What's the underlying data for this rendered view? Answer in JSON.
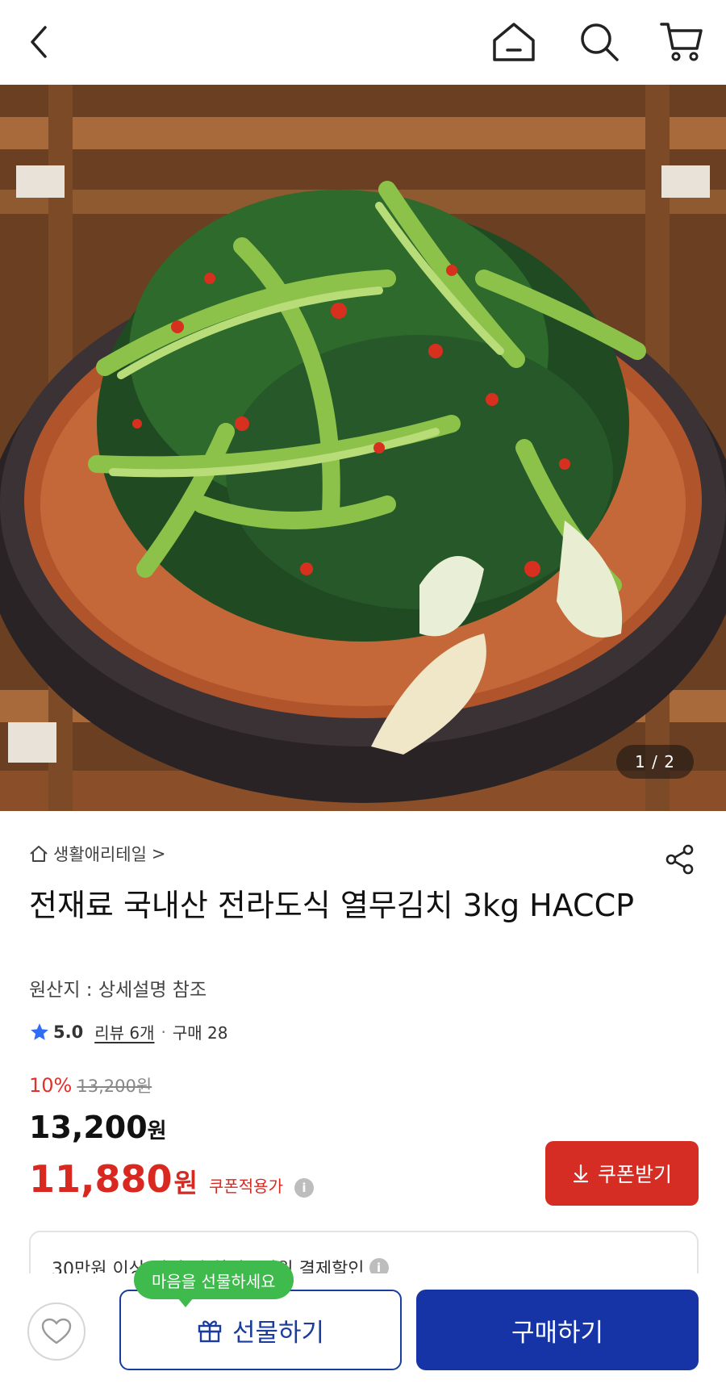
{
  "header": {
    "back_icon": "chevron-left-icon",
    "home_icon": "home-icon",
    "search_icon": "search-icon",
    "cart_icon": "cart-icon"
  },
  "gallery": {
    "pager": "1 / 2"
  },
  "product": {
    "seller": "생활애리테일",
    "seller_arrow": ">",
    "title": "전재료 국내산 전라도식 열무김치 3kg HACCP",
    "origin": "원산지 : 상세설명 참조",
    "rating": "5.0",
    "review_label": "리뷰 6개",
    "separator": "·",
    "purchase_count": "구매 28"
  },
  "pricing": {
    "discount_rate": "10%",
    "original_price": "13,200원",
    "price_value": "13,200",
    "price_unit": "원",
    "coupon_price_value": "11,880",
    "coupon_price_unit": "원",
    "coupon_price_label": "쿠폰적용가",
    "info_glyph": "i",
    "coupon_button": "쿠폰받기",
    "accent_color": "#d52d24"
  },
  "promo": {
    "text": "30만원 이상 결제 시 최대 1만원 결제할인"
  },
  "bottom_bar": {
    "gift_bubble": "마음을 선물하세요",
    "gift_button": "선물하기",
    "buy_button": "구매하기",
    "primary_color": "#1634a6",
    "bubble_color": "#3fba4d"
  }
}
